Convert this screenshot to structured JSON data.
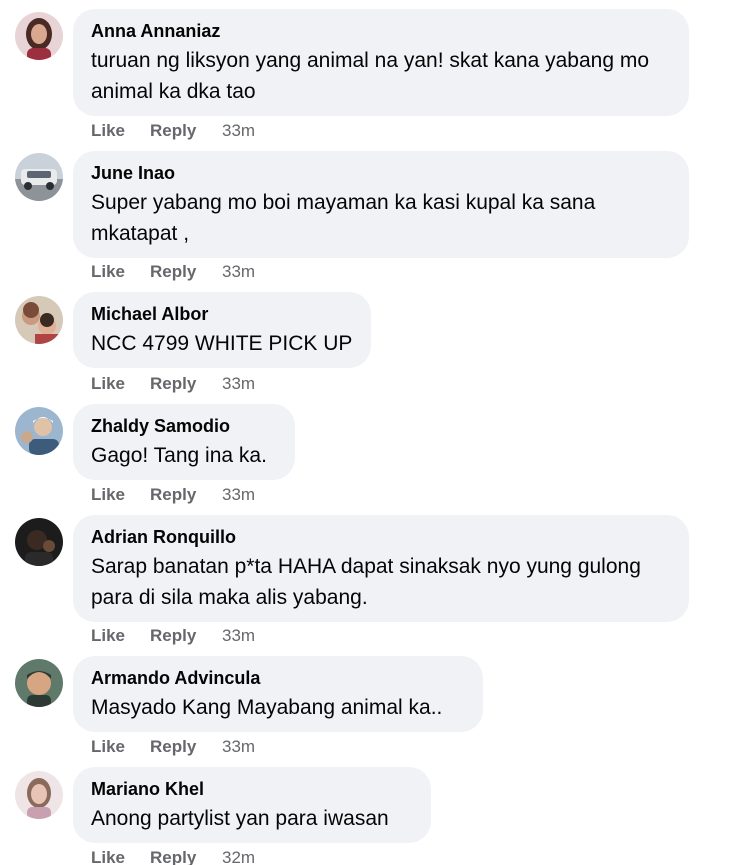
{
  "comments": [
    {
      "author": "Anna Annaniaz",
      "text": "turuan ng liksyon yang animal na yan! skat kana yabang mo animal ka dka tao",
      "like_label": "Like",
      "reply_label": "Reply",
      "time": "33m",
      "avatar_icon": "profile-photo-woman",
      "avatar_colors": [
        "#e8d3d6",
        "#4a2a24",
        "#c09080"
      ]
    },
    {
      "author": "June Inao",
      "text": "Super yabang mo boi mayaman ka kasi kupal ka sana mkatapat ,",
      "like_label": "Like",
      "reply_label": "Reply",
      "time": "33m",
      "avatar_icon": "profile-photo-car",
      "avatar_colors": [
        "#c9d1db",
        "#5b6470",
        "#e8eaec"
      ]
    },
    {
      "author": "Michael Albor",
      "text": "NCC 4799 WHITE PICK UP",
      "like_label": "Like",
      "reply_label": "Reply",
      "time": "33m",
      "avatar_icon": "profile-photo-family",
      "avatar_colors": [
        "#d7c9b8",
        "#7b4b3a",
        "#b7a58f"
      ]
    },
    {
      "author": "Zhaldy Samodio",
      "text": "Gago! Tang ina ka.",
      "like_label": "Like",
      "reply_label": "Reply",
      "time": "33m",
      "avatar_icon": "profile-photo-man",
      "avatar_colors": [
        "#9db6cf",
        "#3d5b7a",
        "#e0d2c2"
      ]
    },
    {
      "author": "Adrian Ronquillo",
      "text": "Sarap banatan p*ta HAHA dapat sinaksak nyo yung gulong para di sila maka alis yabang.",
      "like_label": "Like",
      "reply_label": "Reply",
      "time": "33m",
      "avatar_icon": "profile-photo-dark",
      "avatar_colors": [
        "#1c1c1c",
        "#3a2a22",
        "#6b4a3a"
      ]
    },
    {
      "author": "Armando Advincula",
      "text": "Masyado Kang Mayabang animal ka..",
      "like_label": "Like",
      "reply_label": "Reply",
      "time": "33m",
      "avatar_icon": "profile-photo-child",
      "avatar_colors": [
        "#5f7a6a",
        "#d6a582",
        "#2d3a33"
      ]
    },
    {
      "author": "Mariano Khel",
      "text": "Anong partylist yan para iwasan",
      "like_label": "Like",
      "reply_label": "Reply",
      "time": "32m",
      "avatar_icon": "profile-photo-woman-light",
      "avatar_colors": [
        "#efe4e6",
        "#8a6a5a",
        "#d7b4a8"
      ]
    }
  ],
  "colors": {
    "bubble": "#f0f2f5",
    "name": "#050505",
    "meta": "#65676b"
  }
}
